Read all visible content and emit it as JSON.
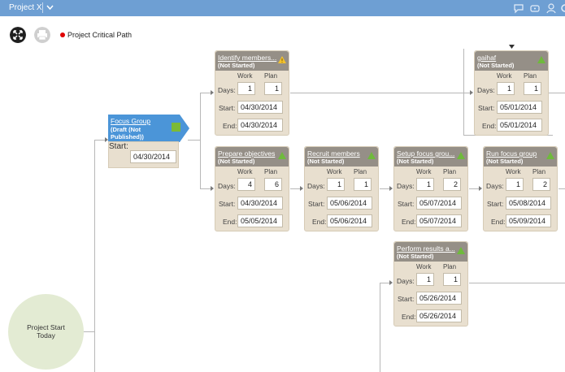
{
  "app": {
    "project_title": "Project X",
    "legend_label": "Project Critical Path"
  },
  "colors": {
    "topbar": "#6e9fd3",
    "card_header": "#958f87",
    "card_body": "#e8dfcf",
    "focus_group_header": "#4b95d8",
    "critical_dot": "#e00000",
    "ok_indicator": "#6fba3c",
    "warning_indicator": "#f2c12e",
    "start_circle": "#e3ebd3"
  },
  "icons": {
    "topbar": [
      "chat-icon",
      "message-icon",
      "user-icon",
      "settings-icon"
    ],
    "toolbar": [
      "fit-to-screen-icon",
      "print-icon"
    ]
  },
  "labels": {
    "work": "Work",
    "plan": "Plan",
    "days": "Days:",
    "start": "Start:",
    "end": "End:"
  },
  "start_node": {
    "line1": "Project Start",
    "line2": "Today"
  },
  "focus_group": {
    "name": "Focus Group",
    "status": "(Draft (Not Published))",
    "start": "04/30/2014"
  },
  "tasks": {
    "identify": {
      "name": "Identify members...",
      "status": "(Not Started)",
      "work": "1",
      "plan": "1",
      "start": "04/30/2014",
      "end": "04/30/2014",
      "indicator": "warning"
    },
    "gaihaf": {
      "name": "gaihaf",
      "status": "(Not Started)",
      "work": "1",
      "plan": "1",
      "start": "05/01/2014",
      "end": "05/01/2014",
      "indicator": "ok"
    },
    "prepare": {
      "name": "Prepare objectives",
      "status": "(Not Started)",
      "work": "4",
      "plan": "6",
      "start": "04/30/2014",
      "end": "05/05/2014",
      "indicator": "ok"
    },
    "recruit": {
      "name": "Recruit members",
      "status": "(Not Started)",
      "work": "1",
      "plan": "1",
      "start": "05/06/2014",
      "end": "05/06/2014",
      "indicator": "ok"
    },
    "setup": {
      "name": "Setup focus grou...",
      "status": "(Not Started)",
      "work": "1",
      "plan": "2",
      "start": "05/07/2014",
      "end": "05/07/2014",
      "indicator": "ok"
    },
    "run": {
      "name": "Run focus group",
      "status": "(Not Started)",
      "work": "1",
      "plan": "2",
      "start": "05/08/2014",
      "end": "05/09/2014",
      "indicator": "ok"
    },
    "perform": {
      "name": "Perform results a...",
      "status": "(Not Started)",
      "work": "1",
      "plan": "1",
      "start": "05/26/2014",
      "end": "05/26/2014",
      "indicator": "ok"
    }
  }
}
